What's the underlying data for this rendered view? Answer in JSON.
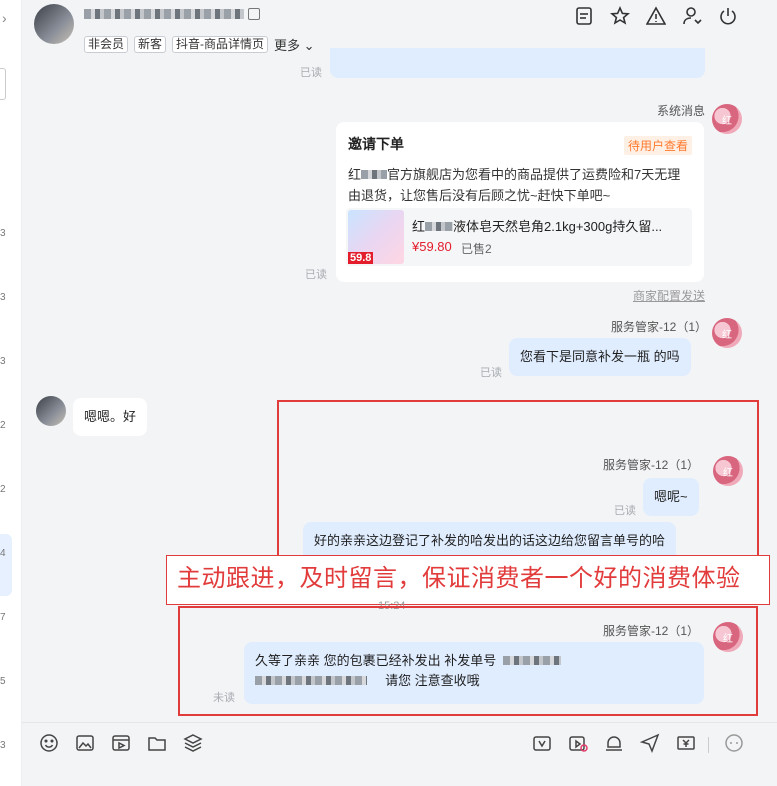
{
  "header": {
    "tags": [
      "非会员",
      "新客",
      "抖音-商品详情页"
    ],
    "more_label": "更多"
  },
  "read_label": "已读",
  "unread_label": "未读",
  "left_numbers": [
    "3",
    "3",
    "3",
    "2",
    "2",
    "4",
    "7",
    "5",
    "3"
  ],
  "system_message": {
    "sender": "系统消息",
    "card_title": "邀请下单",
    "status_badge": "待用户查看",
    "body_prefix": "红",
    "body_text": "官方旗舰店为您看中的商品提供了运费险和7天无理由退货，让您售后没有后顾之忧~赶快下单吧~",
    "product": {
      "name_prefix": "红",
      "name_rest": "液体皂天然皂角2.1kg+300g持久留...",
      "price": "¥59.80",
      "sold": "已售2",
      "image_price": "59.8"
    },
    "config_link": "商家配置发送"
  },
  "messages": [
    {
      "sender": "服务管家-12（1）",
      "text": "您看下是同意补发一瓶 的吗",
      "read": "已读"
    },
    {
      "sender": "",
      "text": "嗯嗯。好"
    },
    {
      "sender": "服务管家-12（1）",
      "text": "嗯呢~",
      "read": "已读"
    },
    {
      "sender": "",
      "text": "好的亲亲这边登记了补发的哈发出的话这边给您留言单号的哈"
    },
    {
      "sender": "服务管家-12（1）",
      "text_line1": "久等了亲亲  您的包裹已经补发出  补发单号",
      "text_line2": "请您 注意查收哦",
      "read": "未读"
    }
  ],
  "annotation": "主动跟进，及时留言，保证消费者一个好的消费体验",
  "timestamp": "15:24",
  "avatar_label": "红"
}
